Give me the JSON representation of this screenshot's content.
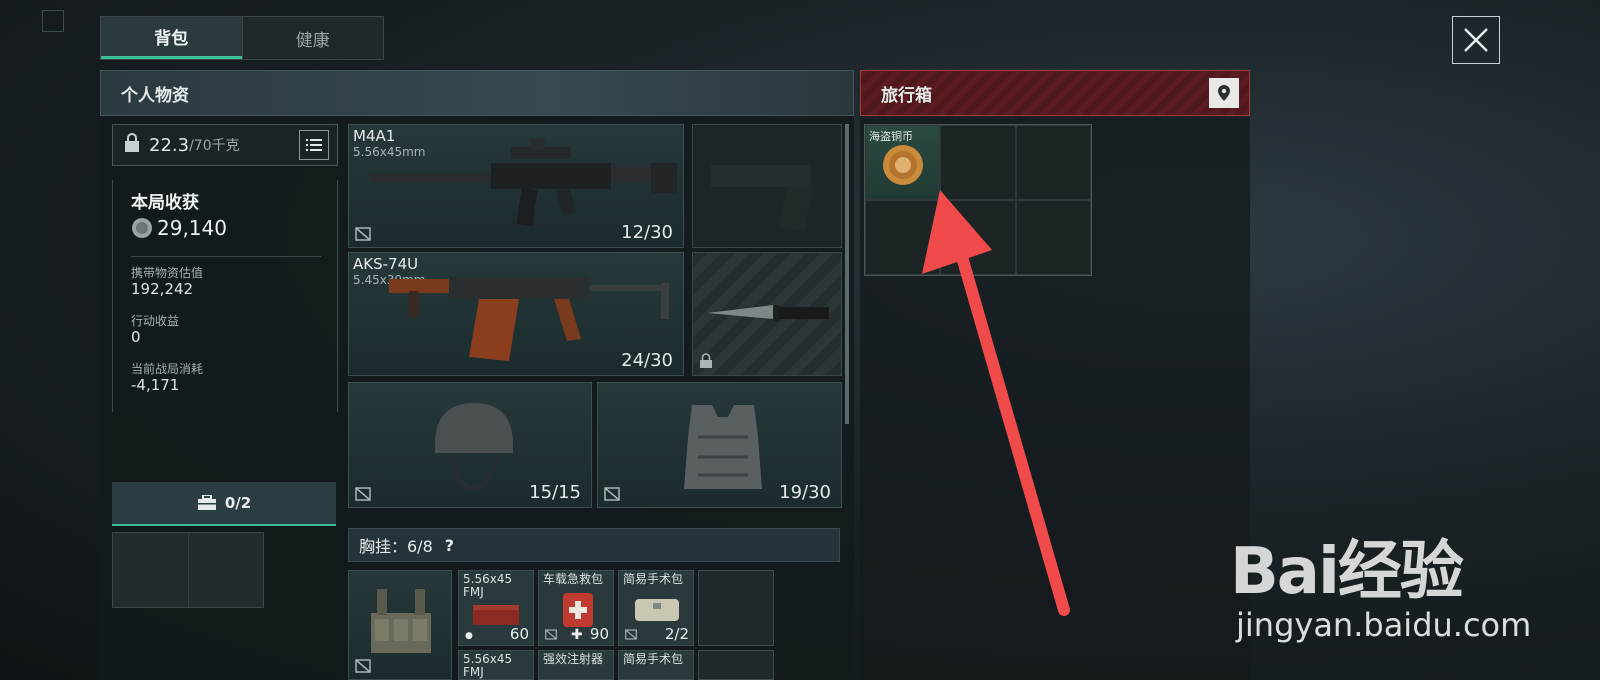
{
  "tabs": [
    {
      "label": "背包",
      "active": true
    },
    {
      "label": "健康",
      "active": false
    }
  ],
  "personal": {
    "title": "个人物资",
    "weight_current": "22.3",
    "weight_max": "/70千克",
    "haul_title": "本局收获",
    "haul_value": "29,140",
    "stats": [
      {
        "label": "携带物资估值",
        "value": "192,242"
      },
      {
        "label": "行动收益",
        "value": "0"
      },
      {
        "label": "当前战局消耗",
        "value": "-4,171"
      }
    ],
    "case_label": "0/2"
  },
  "weapons": [
    {
      "name": "M4A1",
      "ammo": "5.56x45mm",
      "count": "12/30"
    },
    {
      "name": "AKS-74U",
      "ammo": "5.45x39mm",
      "count": "24/30"
    }
  ],
  "armor": [
    {
      "name": "helmet",
      "count": "15/15"
    },
    {
      "name": "vest",
      "count": "19/30"
    }
  ],
  "chest_rig": {
    "label": "胸挂：6/8",
    "help": "?",
    "items": [
      {
        "name": "5.56x45 FMJ",
        "count": "60"
      },
      {
        "name": "车载急救包",
        "count": "90"
      },
      {
        "name": "简易手术包",
        "count": "2/2"
      },
      {
        "name": "5.56x45 FMJ",
        "count": ""
      },
      {
        "name": "强效注射器",
        "count": ""
      },
      {
        "name": "简易手术包",
        "count": ""
      }
    ]
  },
  "trunk": {
    "title": "旅行箱",
    "item_label": "海盗铜币"
  },
  "watermark": {
    "logo": "Bai经验",
    "url": "jingyan.baidu.com"
  },
  "colors": {
    "accent": "#3dbf9a",
    "trunk_red": "#a33a40",
    "arrow": "#f04a4a"
  }
}
